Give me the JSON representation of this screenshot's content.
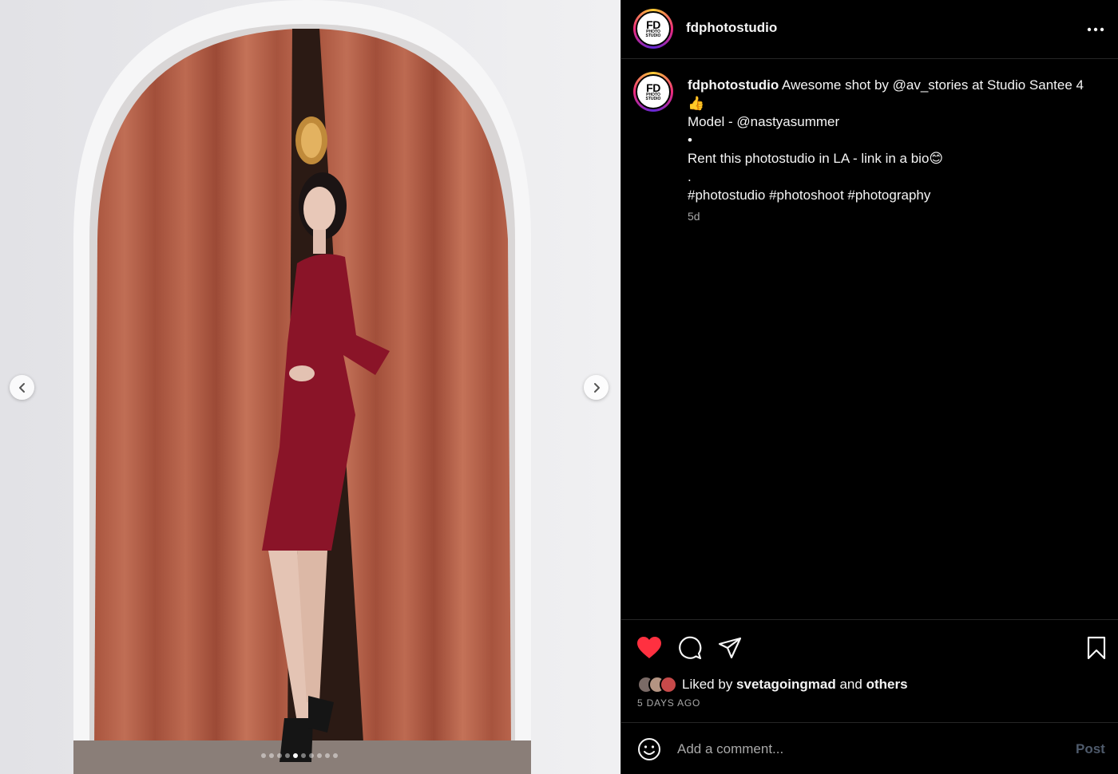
{
  "post": {
    "username": "fdphotostudio",
    "avatar_text": "FD",
    "avatar_subtext": "PHOTO STUDIO"
  },
  "media": {
    "slide_count": 10,
    "active_slide": 4,
    "prev_icon": "chevron-left-icon",
    "next_icon": "chevron-right-icon"
  },
  "caption": {
    "username": "fdphotostudio",
    "line1": " Awesome shot by @av_stories at Studio Santee 4👍",
    "line2": "Model - @nastyasummer",
    "line3": "•",
    "line4": "Rent this photostudio in LA - link in a bio😊",
    "line5": ".",
    "line6": "#photostudio #photoshoot #photography",
    "time": "5d"
  },
  "actions": {
    "like_icon": "heart-filled-icon",
    "comment_icon": "comment-icon",
    "share_icon": "send-icon",
    "save_icon": "bookmark-icon",
    "liked_prefix": "Liked by ",
    "liked_user": "svetagoingmad",
    "liked_and": " and ",
    "liked_others": "others",
    "days_ago": "5 DAYS AGO"
  },
  "comment": {
    "placeholder": "Add a comment...",
    "post_label": "Post",
    "emoji_icon": "emoji-icon"
  },
  "colors": {
    "background": "#000000",
    "heart": "#ff3040",
    "muted": "#a8a8a8",
    "post_disabled": "#4e5a6b",
    "curtain": "#b8644c",
    "dress": "#8a1428",
    "wall": "#e9e9ec"
  }
}
